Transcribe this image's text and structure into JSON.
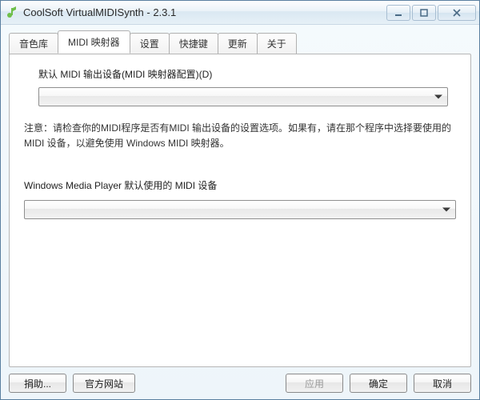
{
  "window": {
    "title": "CoolSoft VirtualMIDISynth - 2.3.1"
  },
  "tabs": [
    {
      "label": "音色库"
    },
    {
      "label": "MIDI 映射器"
    },
    {
      "label": "设置"
    },
    {
      "label": "快捷键"
    },
    {
      "label": "更新"
    },
    {
      "label": "关于"
    }
  ],
  "mapper": {
    "default_device_label": "默认 MIDI 输出设备(MIDI 映射器配置)(D)",
    "default_device_value": "",
    "note": "注意：请检查你的MIDI程序是否有MIDI 输出设备的设置选项。如果有，请在那个程序中选择要使用的 MIDI 设备，以避免使用 Windows MIDI 映射器。",
    "wmp_label": "Windows Media Player 默认使用的 MIDI 设备",
    "wmp_value": ""
  },
  "buttons": {
    "donate": "捐助...",
    "website": "官方网站",
    "apply": "应用",
    "ok": "确定",
    "cancel": "取消"
  }
}
